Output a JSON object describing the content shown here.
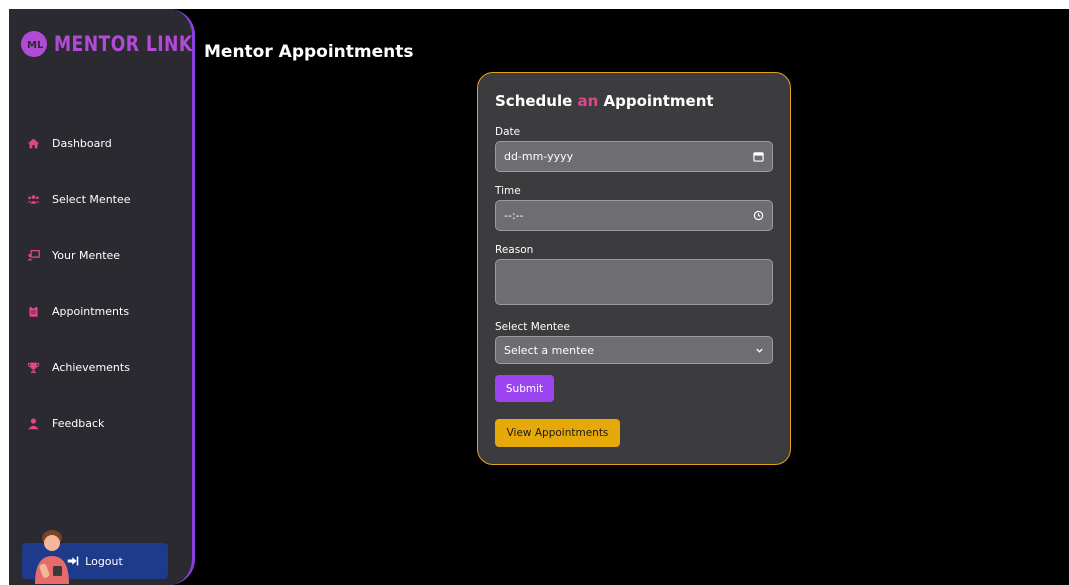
{
  "brand": {
    "name": "MENTOR LINK",
    "icon": "mentor-link-logo-icon",
    "color": "#b24ad8"
  },
  "sidebar": {
    "items": [
      {
        "label": "Dashboard",
        "icon": "home-icon"
      },
      {
        "label": "Select Mentee",
        "icon": "users-icon"
      },
      {
        "label": "Your Mentee",
        "icon": "chalkboard-user-icon"
      },
      {
        "label": "Appointments",
        "icon": "clipboard-icon"
      },
      {
        "label": "Achievements",
        "icon": "trophy-icon"
      },
      {
        "label": "Feedback",
        "icon": "user-icon"
      }
    ],
    "logout_label": "Logout",
    "logout_icon": "sign-out-icon"
  },
  "page": {
    "title": "Mentor Appointments"
  },
  "form": {
    "title_pre": "Schedule ",
    "title_accent": "an",
    "title_post": " Appointment",
    "date_label": "Date",
    "date_placeholder": "dd-mm-yyyy",
    "time_label": "Time",
    "time_placeholder": "--:--",
    "reason_label": "Reason",
    "reason_value": "",
    "mentee_label": "Select Mentee",
    "mentee_selected": "Select a mentee",
    "submit_label": "Submit",
    "view_label": "View Appointments"
  },
  "colors": {
    "accent_purple": "#9b45f0",
    "accent_pink": "#e0468a",
    "accent_gold": "#e5aa0a",
    "sidebar_border": "#8b3fe0",
    "logout_bg": "#1e3a8a"
  }
}
